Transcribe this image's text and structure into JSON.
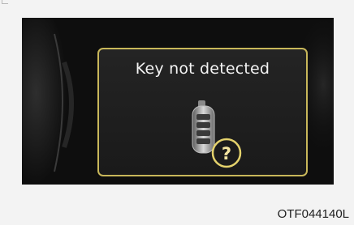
{
  "warning": {
    "message": "Key not detected",
    "badge_symbol": "?"
  },
  "icons": {
    "key_fob": "smart-key-fob-icon",
    "help": "question-mark-circle-icon"
  },
  "colors": {
    "popup_border": "#c8b75a",
    "badge_ring": "#e4d26c",
    "panel_background": "#0e0e0e"
  },
  "image_code": "OTF044140L"
}
